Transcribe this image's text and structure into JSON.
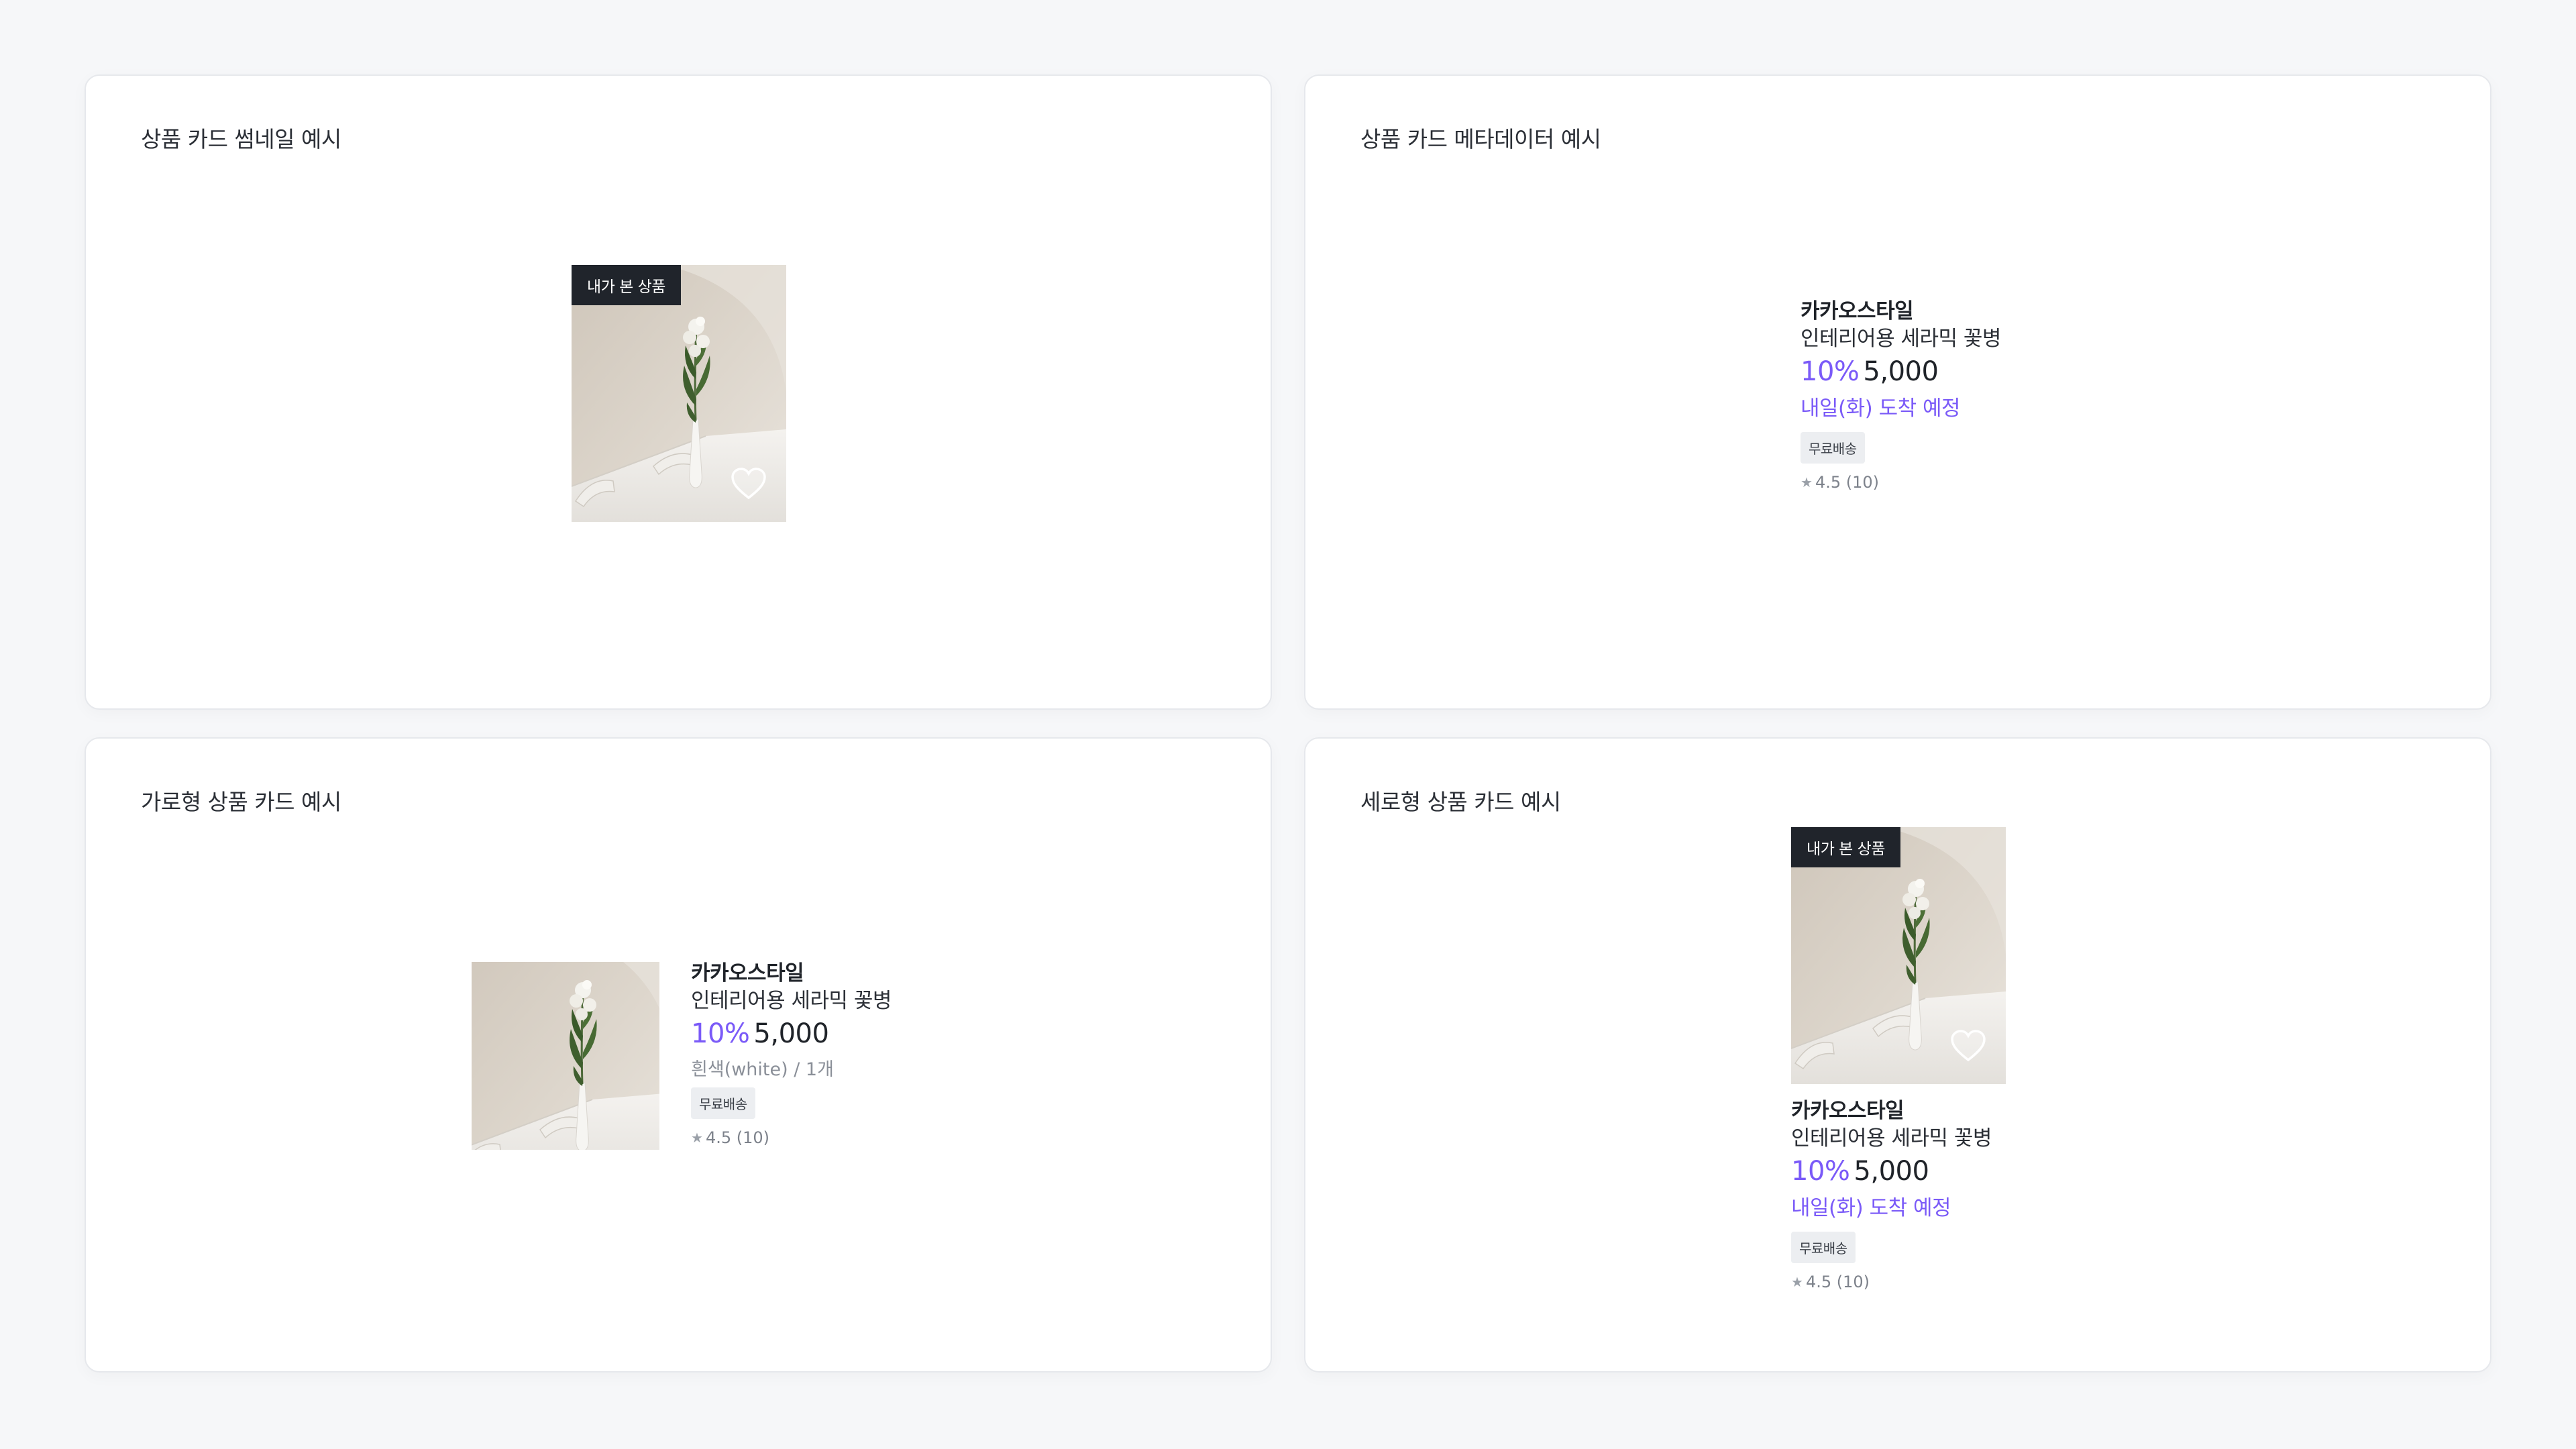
{
  "panels": {
    "thumbnail": {
      "title": "상품 카드 썸네일 예시"
    },
    "metadata": {
      "title": "상품 카드 메타데이터 예시"
    },
    "horizontal": {
      "title": "가로형 상품 카드 예시"
    },
    "vertical": {
      "title": "세로형 상품 카드 예시"
    }
  },
  "product": {
    "seen_badge": "내가 본 상품",
    "brand": "카카오스타일",
    "name": "인테리어용 세라믹 꽃병",
    "discount": "10%",
    "price": "5,000",
    "delivery": "내일(화) 도착 예정",
    "option": "흰색(white) / 1개",
    "tag": "무료배송",
    "rating": "4.5 (10)",
    "icons": {
      "wishlist": "heart-icon",
      "rating": "star-icon"
    }
  },
  "colors": {
    "accent": "#7a5af8",
    "badge_bg": "#20242b",
    "tag_bg": "#eceef1",
    "page_bg": "#f6f7f9"
  }
}
